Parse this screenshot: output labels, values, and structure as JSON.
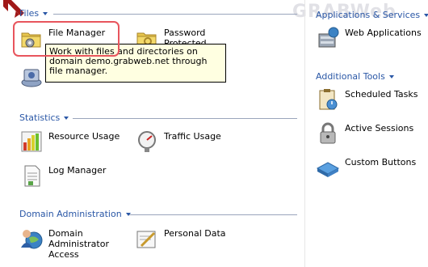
{
  "watermark": "GRABWeb",
  "left": {
    "files": {
      "title": "Files",
      "items": [
        {
          "label": "File Manager"
        },
        {
          "label": "Password Protected"
        },
        {
          "label": ""
        }
      ]
    },
    "statistics": {
      "title": "Statistics",
      "items": [
        {
          "label": "Resource Usage"
        },
        {
          "label": "Traffic Usage"
        },
        {
          "label": "Log Manager"
        }
      ]
    },
    "domain_admin": {
      "title": "Domain Administration",
      "items": [
        {
          "label": "Domain Administrator Access"
        },
        {
          "label": "Personal Data"
        }
      ]
    }
  },
  "right": {
    "applications": {
      "title": "Applications & Services",
      "items": [
        {
          "label": "Web Applications"
        }
      ]
    },
    "additional": {
      "title": "Additional Tools",
      "items": [
        {
          "label": "Scheduled Tasks"
        },
        {
          "label": "Active Sessions"
        },
        {
          "label": "Custom Buttons"
        }
      ]
    }
  },
  "tooltip": {
    "text": "Work with files and directories on domain demo.grabweb.net through file manager."
  },
  "colors": {
    "section_title": "#2a57a6",
    "tooltip_bg": "#ffffe1",
    "highlight": "#e8555d",
    "arrow": "#a01818"
  }
}
